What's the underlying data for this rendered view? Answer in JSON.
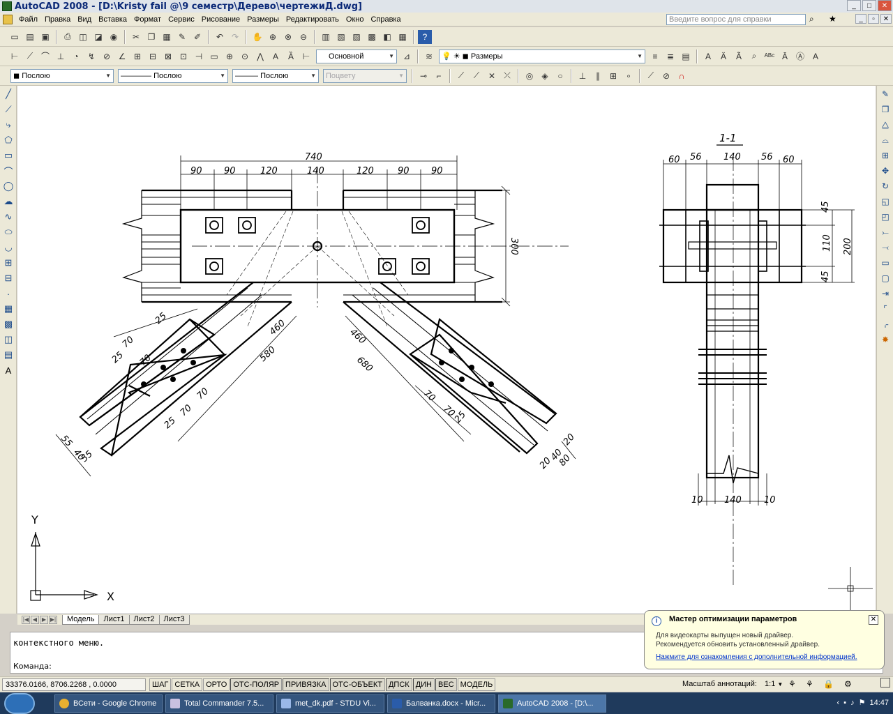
{
  "window": {
    "title": "AutoCAD 2008 - [D:\\Kristy fail @\\9 семестр\\Дерево\\чертежиД.dwg]"
  },
  "menu": [
    "Файл",
    "Правка",
    "Вид",
    "Вставка",
    "Формат",
    "Сервис",
    "Рисование",
    "Размеры",
    "Редактировать",
    "Окно",
    "Справка"
  ],
  "help": {
    "placeholder": "Введите вопрос для справки"
  },
  "toolbar2": {
    "text_style": "Основной",
    "dim_style": "Размеры"
  },
  "toolbar3": {
    "layer": "Послою",
    "linetype": "Послою",
    "lineweight": "Послою",
    "plotstyle": "Поцвету"
  },
  "drawing": {
    "section_label": "1-1",
    "dims_top": [
      "740",
      "90",
      "90",
      "120",
      "140",
      "120",
      "90",
      "90"
    ],
    "dim_height": "300",
    "dims_diag_left": [
      "460",
      "580",
      "70",
      "70",
      "25",
      "25",
      "70",
      "70",
      "25",
      "55",
      "40",
      "55"
    ],
    "dims_diag_right": [
      "460",
      "680",
      "70",
      "70",
      "25",
      "20",
      "40",
      "80",
      "20"
    ],
    "section_dims_top": [
      "60",
      "56",
      "140",
      "56",
      "60"
    ],
    "section_dims_right": [
      "45",
      "110",
      "45",
      "200"
    ],
    "section_dims_bottom": [
      "10",
      "140",
      "10"
    ],
    "ucs_y": "Y",
    "ucs_x": "X"
  },
  "tabs": [
    "Модель",
    "Лист1",
    "Лист2",
    "Лист3"
  ],
  "command": {
    "history": "контекстного меню.",
    "prompt": "Команда:"
  },
  "status": {
    "coords": "33376.0166, 8706.2268 , 0.0000",
    "buttons": [
      "ШАГ",
      "СЕТКА",
      "ОРТО",
      "ОТС-ПОЛЯР",
      "ПРИВЯЗКА",
      "ОТС-ОБЪЕКТ",
      "ДПСК",
      "ДИН",
      "ВЕС",
      "МОДЕЛЬ"
    ],
    "annotation_scale_label": "Масштаб аннотаций:",
    "annotation_scale_value": "1:1"
  },
  "balloon": {
    "title": "Мастер оптимизации параметров",
    "line1": "Для видеокарты выпущен новый драйвер.",
    "line2": "Рекомендуется обновить установленный драйвер.",
    "link": "Нажмите для ознакомления с дополнительной информацией."
  },
  "taskbar": {
    "tasks": [
      "ВСети - Google Chrome",
      "Total Commander 7.5...",
      "met_dk.pdf - STDU Vi...",
      "Балванка.docx - Micr...",
      "AutoCAD 2008 - [D:\\..."
    ],
    "clock": "14:47"
  }
}
